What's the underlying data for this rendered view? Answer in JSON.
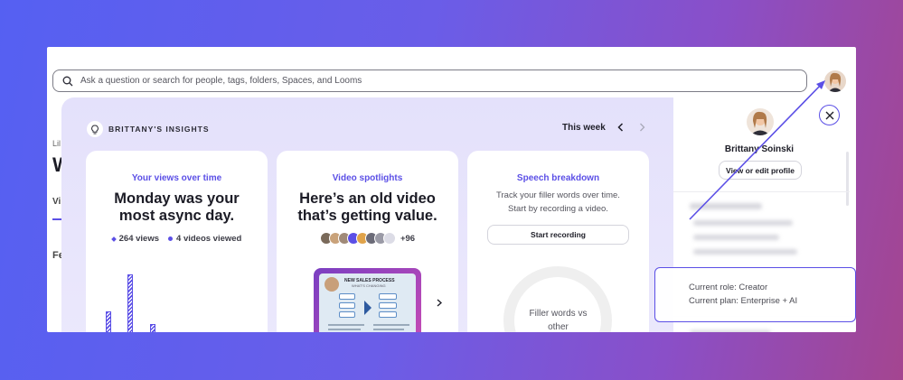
{
  "search": {
    "placeholder": "Ask a question or search for people, tags, folders, Spaces, and Looms"
  },
  "background": {
    "line1": "Lil",
    "line2": "W",
    "tab": "Vi",
    "line3": "Fe"
  },
  "insights": {
    "header": "BRITTANY'S INSIGHTS",
    "period": "This week",
    "cards": [
      {
        "title": "Your views over time",
        "headline": "Monday was your most async day.",
        "stat_views": "264 views",
        "stat_videos": "4 videos viewed",
        "bars": [
          0.45,
          0.95,
          0.28
        ]
      },
      {
        "title": "Video spotlights",
        "headline": "Here’s an old video that’s getting value.",
        "plus_count": "+96",
        "thumb_title": "NEW SALES PROCESS",
        "thumb_subtitle": "WHAT'S CHANGING"
      },
      {
        "title": "Speech breakdown",
        "subtitle": "Track your filler words over time. Start by recording a video.",
        "button": "Start recording",
        "donut_label": "Filler words vs other"
      }
    ]
  },
  "profile": {
    "name": "Brittany Soinski",
    "button": "View or edit profile"
  },
  "role": {
    "role_line": "Current role: Creator",
    "plan_line": "Current plan: Enterprise + AI"
  },
  "colors": {
    "accent": "#5b4fe6",
    "panel": "#e6e3fb"
  },
  "icons": [
    "search-icon",
    "bulb-icon",
    "chevron-left-icon",
    "chevron-right-icon",
    "close-icon",
    "bolt-icon",
    "dot-icon"
  ]
}
